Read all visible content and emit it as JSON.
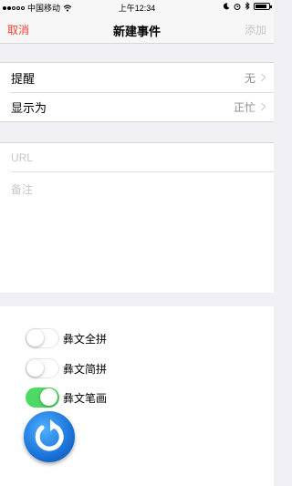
{
  "status_bar": {
    "carrier": "中国移动",
    "time": "上午12:34",
    "battery_level": 0.85
  },
  "nav": {
    "cancel_label": "取消",
    "title": "新建事件",
    "add_label": "添加"
  },
  "settings": [
    {
      "label": "提醒",
      "value": "无"
    },
    {
      "label": "显示为",
      "value": "正忙"
    }
  ],
  "notes": {
    "url_placeholder": "URL",
    "memo_placeholder": "备注"
  },
  "toggles": [
    {
      "label": "彝文全拼",
      "on": false
    },
    {
      "label": "彝文简拼",
      "on": false
    },
    {
      "label": "彝文笔画",
      "on": true
    }
  ],
  "colors": {
    "accent_red": "#ff3b30",
    "toggle_on": "#4cd964",
    "disabled": "#c7c7cc"
  },
  "icons": {
    "signal": "signal-dots-icon",
    "wifi": "wifi-icon",
    "moon": "moon-icon",
    "alarm": "alarm-icon",
    "bluetooth": "bluetooth-icon",
    "battery": "battery-icon",
    "refresh": "refresh-icon"
  }
}
